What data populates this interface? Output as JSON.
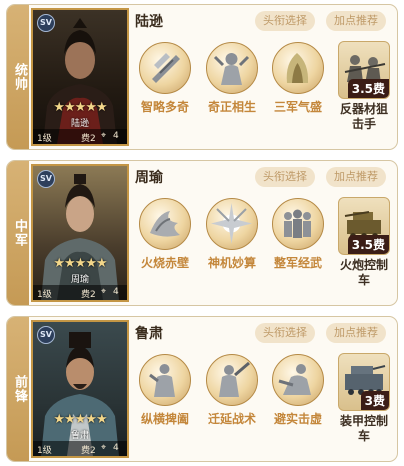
{
  "cards": [
    {
      "rail": "统帅",
      "name": "陆逊",
      "portrait": {
        "badge": "SV",
        "stars": "★★★★★",
        "name": "陆逊",
        "level": "1级",
        "cost": "费2",
        "count": "4"
      },
      "buttons": {
        "title": "头衔选择",
        "recommend": "加点推荐"
      },
      "skills": [
        {
          "name": "智略多奇",
          "icon": "scroll-icon"
        },
        {
          "name": "奇正相生",
          "icon": "guardian-icon"
        },
        {
          "name": "三军气盛",
          "icon": "banner-icon"
        }
      ],
      "equipment": {
        "cost": "3.5费",
        "name": "反器材狙击手",
        "icon": "sniper-squad-icon"
      }
    },
    {
      "rail": "中军",
      "name": "周瑜",
      "portrait": {
        "badge": "SV",
        "stars": "★★★★★",
        "name": "周瑜",
        "level": "1级",
        "cost": "费2",
        "count": "4"
      },
      "buttons": {
        "title": "头衔选择",
        "recommend": "加点推荐"
      },
      "skills": [
        {
          "name": "火烧赤壁",
          "icon": "fire-icon"
        },
        {
          "name": "神机妙算",
          "icon": "burst-icon"
        },
        {
          "name": "整军经武",
          "icon": "soldiers-icon"
        }
      ],
      "equipment": {
        "cost": "3.5费",
        "name": "火炮控制车",
        "icon": "artillery-vehicle-icon"
      }
    },
    {
      "rail": "前锋",
      "name": "鲁肃",
      "portrait": {
        "badge": "SV",
        "stars": "★★★★★",
        "name": "鲁肃",
        "level": "1级",
        "cost": "费2",
        "count": "4"
      },
      "buttons": {
        "title": "头衔选择",
        "recommend": "加点推荐"
      },
      "skills": [
        {
          "name": "纵横捭阖",
          "icon": "strategist-icon"
        },
        {
          "name": "迁延战术",
          "icon": "warrior-icon"
        },
        {
          "name": "避实击虚",
          "icon": "charge-icon"
        }
      ],
      "equipment": {
        "cost": "3费",
        "name": "装甲控制车",
        "icon": "armored-vehicle-icon"
      }
    }
  ]
}
